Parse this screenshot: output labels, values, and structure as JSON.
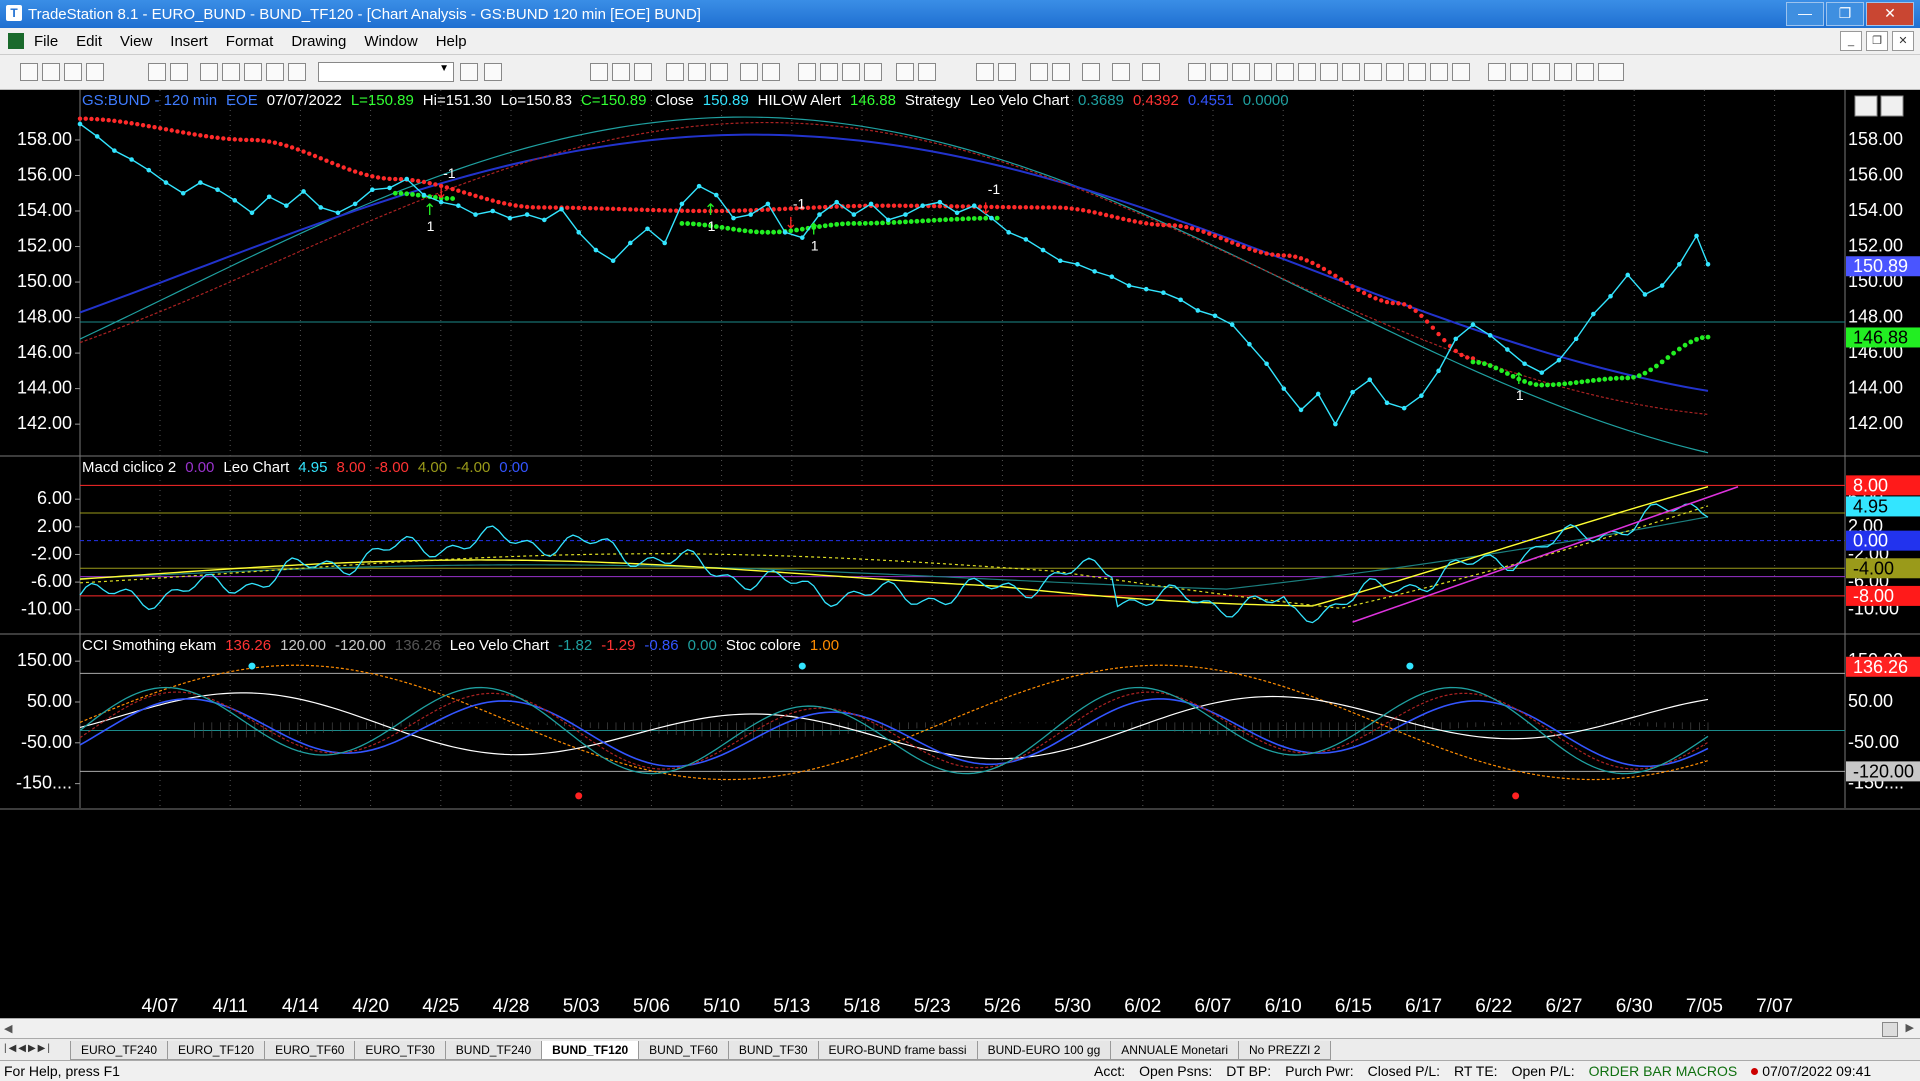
{
  "window": {
    "title": "TradeStation 8.1 - EURO_BUND - BUND_TF120 - [Chart Analysis - GS:BUND  120 min  [EOE] BUND]",
    "buttons": {
      "minimize": "—",
      "restore": "❐",
      "close": "✕"
    }
  },
  "menu": {
    "items": [
      "File",
      "Edit",
      "View",
      "Insert",
      "Format",
      "Drawing",
      "Window",
      "Help"
    ]
  },
  "chart_data": [
    {
      "type": "line",
      "panel": "price",
      "header_items": [
        {
          "text": "GS:BUND - 120 min",
          "color": "#3f7cff"
        },
        {
          "text": "EOE",
          "color": "#3f7cff"
        },
        {
          "text": "07/07/2022",
          "color": "#ffffff"
        },
        {
          "text": "L=150.89",
          "color": "#33ff33"
        },
        {
          "text": "Hi=151.30",
          "color": "#ffffff"
        },
        {
          "text": "Lo=150.83",
          "color": "#ffffff"
        },
        {
          "text": "C=150.89",
          "color": "#33ff33"
        },
        {
          "text": "Close",
          "color": "#ffffff"
        },
        {
          "text": "150.89",
          "color": "#33e5ff"
        },
        {
          "text": "HILOW Alert",
          "color": "#ffffff"
        },
        {
          "text": "146.88",
          "color": "#33ff33"
        },
        {
          "text": "Strategy",
          "color": "#ffffff"
        },
        {
          "text": "Leo Velo Chart",
          "color": "#ffffff"
        },
        {
          "text": "0.3689",
          "color": "#1fa0a0"
        },
        {
          "text": "0.4392",
          "color": "#ff3333"
        },
        {
          "text": "0.4551",
          "color": "#3355ff"
        },
        {
          "text": "0.0000",
          "color": "#1fa0a0"
        }
      ],
      "y_ticks": [
        "158.00",
        "156.00",
        "154.00",
        "152.00",
        "150.00",
        "148.00",
        "146.00",
        "144.00",
        "142.00"
      ],
      "ylim": [
        140.6,
        159.8
      ],
      "right_badges": [
        {
          "text": "150.89",
          "value": 150.89,
          "bg": "#4a55ff",
          "fg": "#ffffff"
        },
        {
          "text": "146.88",
          "value": 146.88,
          "bg": "#22ee22",
          "fg": "#000000"
        }
      ],
      "horizontal_lines": [
        {
          "value": 147.75,
          "color": "#1b8a8a"
        }
      ],
      "close_series": [
        {
          "x": 0,
          "y": 158.9
        },
        {
          "x": 3,
          "y": 158.2
        },
        {
          "x": 6,
          "y": 157.4
        },
        {
          "x": 9,
          "y": 156.9
        },
        {
          "x": 12,
          "y": 156.3
        },
        {
          "x": 15,
          "y": 155.6
        },
        {
          "x": 18,
          "y": 155.0
        },
        {
          "x": 21,
          "y": 155.6
        },
        {
          "x": 24,
          "y": 155.2
        },
        {
          "x": 27,
          "y": 154.6
        },
        {
          "x": 30,
          "y": 153.9
        },
        {
          "x": 33,
          "y": 154.8
        },
        {
          "x": 36,
          "y": 154.3
        },
        {
          "x": 39,
          "y": 155.1
        },
        {
          "x": 42,
          "y": 154.2
        },
        {
          "x": 45,
          "y": 153.9
        },
        {
          "x": 48,
          "y": 154.4
        },
        {
          "x": 51,
          "y": 155.2
        },
        {
          "x": 54,
          "y": 155.3
        },
        {
          "x": 57,
          "y": 155.8
        },
        {
          "x": 60,
          "y": 154.9
        },
        {
          "x": 63,
          "y": 154.5
        },
        {
          "x": 66,
          "y": 154.3
        },
        {
          "x": 69,
          "y": 153.8
        },
        {
          "x": 72,
          "y": 154.0
        },
        {
          "x": 75,
          "y": 153.6
        },
        {
          "x": 78,
          "y": 153.8
        },
        {
          "x": 81,
          "y": 153.5
        },
        {
          "x": 84,
          "y": 154.1
        },
        {
          "x": 87,
          "y": 152.8
        },
        {
          "x": 90,
          "y": 151.8
        },
        {
          "x": 93,
          "y": 151.2
        },
        {
          "x": 96,
          "y": 152.2
        },
        {
          "x": 99,
          "y": 153.0
        },
        {
          "x": 102,
          "y": 152.2
        },
        {
          "x": 105,
          "y": 154.4
        },
        {
          "x": 108,
          "y": 155.4
        },
        {
          "x": 111,
          "y": 154.9
        },
        {
          "x": 114,
          "y": 153.6
        },
        {
          "x": 117,
          "y": 153.8
        },
        {
          "x": 120,
          "y": 154.4
        },
        {
          "x": 123,
          "y": 152.8
        },
        {
          "x": 126,
          "y": 152.5
        },
        {
          "x": 129,
          "y": 153.8
        },
        {
          "x": 132,
          "y": 154.5
        },
        {
          "x": 135,
          "y": 153.8
        },
        {
          "x": 138,
          "y": 154.4
        },
        {
          "x": 141,
          "y": 153.5
        },
        {
          "x": 144,
          "y": 153.8
        },
        {
          "x": 147,
          "y": 154.3
        },
        {
          "x": 150,
          "y": 154.5
        },
        {
          "x": 153,
          "y": 153.9
        },
        {
          "x": 156,
          "y": 154.3
        },
        {
          "x": 159,
          "y": 153.6
        },
        {
          "x": 162,
          "y": 152.8
        },
        {
          "x": 165,
          "y": 152.4
        },
        {
          "x": 168,
          "y": 151.8
        },
        {
          "x": 171,
          "y": 151.2
        },
        {
          "x": 174,
          "y": 151.0
        },
        {
          "x": 177,
          "y": 150.6
        },
        {
          "x": 180,
          "y": 150.3
        },
        {
          "x": 183,
          "y": 149.8
        },
        {
          "x": 186,
          "y": 149.6
        },
        {
          "x": 189,
          "y": 149.4
        },
        {
          "x": 192,
          "y": 149.0
        },
        {
          "x": 195,
          "y": 148.4
        },
        {
          "x": 198,
          "y": 148.1
        },
        {
          "x": 201,
          "y": 147.6
        },
        {
          "x": 204,
          "y": 146.5
        },
        {
          "x": 207,
          "y": 145.4
        },
        {
          "x": 210,
          "y": 144.0
        },
        {
          "x": 213,
          "y": 142.8
        },
        {
          "x": 216,
          "y": 143.7
        },
        {
          "x": 219,
          "y": 142.0
        },
        {
          "x": 222,
          "y": 143.8
        },
        {
          "x": 225,
          "y": 144.5
        },
        {
          "x": 228,
          "y": 143.2
        },
        {
          "x": 231,
          "y": 142.9
        },
        {
          "x": 234,
          "y": 143.6
        },
        {
          "x": 237,
          "y": 145.0
        },
        {
          "x": 240,
          "y": 146.8
        },
        {
          "x": 243,
          "y": 147.6
        },
        {
          "x": 246,
          "y": 147.0
        },
        {
          "x": 249,
          "y": 146.2
        },
        {
          "x": 252,
          "y": 145.4
        },
        {
          "x": 255,
          "y": 144.9
        },
        {
          "x": 258,
          "y": 145.6
        },
        {
          "x": 261,
          "y": 146.8
        },
        {
          "x": 264,
          "y": 148.2
        },
        {
          "x": 267,
          "y": 149.2
        },
        {
          "x": 270,
          "y": 150.4
        },
        {
          "x": 273,
          "y": 149.3
        },
        {
          "x": 276,
          "y": 149.8
        },
        {
          "x": 279,
          "y": 151.0
        },
        {
          "x": 282,
          "y": 152.6
        },
        {
          "x": 284,
          "y": 151.0
        }
      ],
      "red_stop_series": [
        {
          "x": 0,
          "y": 159.2
        },
        {
          "x": 30,
          "y": 158.0
        },
        {
          "x": 55,
          "y": 155.8
        },
        {
          "x": 80,
          "y": 154.2
        },
        {
          "x": 110,
          "y": 154.0
        },
        {
          "x": 140,
          "y": 154.3
        },
        {
          "x": 170,
          "y": 154.2
        },
        {
          "x": 190,
          "y": 153.2
        },
        {
          "x": 210,
          "y": 151.5
        },
        {
          "x": 230,
          "y": 148.8
        },
        {
          "x": 243,
          "y": 145.7
        }
      ],
      "green_stop_series": [
        {
          "type": "segment",
          "points": [
            {
              "x": 55,
              "y": 155.0
            },
            {
              "x": 65,
              "y": 154.7
            }
          ]
        },
        {
          "type": "segment",
          "points": [
            {
              "x": 105,
              "y": 153.3
            },
            {
              "x": 120,
              "y": 152.8
            },
            {
              "x": 135,
              "y": 153.3
            },
            {
              "x": 160,
              "y": 153.6
            }
          ]
        },
        {
          "type": "segment",
          "points": [
            {
              "x": 243,
              "y": 145.5
            },
            {
              "x": 255,
              "y": 144.2
            },
            {
              "x": 270,
              "y": 144.6
            },
            {
              "x": 284,
              "y": 146.9
            }
          ]
        }
      ],
      "signals": [
        {
          "x": 63,
          "label": "-1",
          "dir": "down"
        },
        {
          "x": 61,
          "label": "1",
          "dir": "up"
        },
        {
          "x": 110,
          "label": "1",
          "dir": "up"
        },
        {
          "x": 124,
          "label": "-1",
          "dir": "down"
        },
        {
          "x": 128,
          "label": "1",
          "dir": "up"
        },
        {
          "x": 158,
          "label": "-1",
          "dir": "down"
        },
        {
          "x": 251,
          "label": "1",
          "dir": "up"
        }
      ],
      "x_ticks": [
        "4/07",
        "4/11",
        "4/14",
        "4/20",
        "4/25",
        "4/28",
        "5/03",
        "5/06",
        "5/10",
        "5/13",
        "5/18",
        "5/23",
        "5/26",
        "5/30",
        "6/02",
        "6/07",
        "6/10",
        "6/15",
        "6/17",
        "6/22",
        "6/27",
        "6/30",
        "7/05",
        "7/07"
      ]
    },
    {
      "type": "line",
      "panel": "macd",
      "header_items": [
        {
          "text": "Macd ciclico 2",
          "color": "#ffffff"
        },
        {
          "text": "0.00",
          "color": "#9933cc"
        },
        {
          "text": "Leo Chart",
          "color": "#ffffff"
        },
        {
          "text": "4.95",
          "color": "#33e5ff"
        },
        {
          "text": "8.00",
          "color": "#ff3333"
        },
        {
          "text": "-8.00",
          "color": "#ff3333"
        },
        {
          "text": "4.00",
          "color": "#9a9a1a"
        },
        {
          "text": "-4.00",
          "color": "#9a9a1a"
        },
        {
          "text": "0.00",
          "color": "#3355ff"
        }
      ],
      "y_ticks": [
        "6.00",
        "2.00",
        "-2.00",
        "-6.00",
        "-10.00"
      ],
      "ylim": [
        -12.5,
        9.5
      ],
      "right_badges": [
        {
          "text": "8.00",
          "value": 8.0,
          "bg": "#ff1a1a",
          "fg": "#ffffff"
        },
        {
          "text": "4.95",
          "value": 4.95,
          "bg": "#33e5ff",
          "fg": "#000000"
        },
        {
          "text": "0.00",
          "value": 0.0,
          "bg": "#2233ee",
          "fg": "#ffffff"
        },
        {
          "text": "-4.00",
          "value": -4.0,
          "bg": "#9a9a1a",
          "fg": "#000000"
        },
        {
          "text": "-8.00",
          "value": -8.0,
          "bg": "#ff1a1a",
          "fg": "#ffffff"
        }
      ]
    },
    {
      "type": "line",
      "panel": "cci",
      "header_items": [
        {
          "text": "CCI Smothing ekam",
          "color": "#ffffff"
        },
        {
          "text": "136.26",
          "color": "#ff3333"
        },
        {
          "text": "120.00",
          "color": "#c8c8c8"
        },
        {
          "text": "-120.00",
          "color": "#c8c8c8"
        },
        {
          "text": "136.26",
          "color": "#555555"
        },
        {
          "text": "Leo Velo Chart",
          "color": "#ffffff"
        },
        {
          "text": "-1.82",
          "color": "#1fa0a0"
        },
        {
          "text": "-1.29",
          "color": "#ff3333"
        },
        {
          "text": "-0.86",
          "color": "#3355ff"
        },
        {
          "text": "0.00",
          "color": "#1fa0a0"
        },
        {
          "text": "Stoc colore",
          "color": "#ffffff"
        },
        {
          "text": "1.00",
          "color": "#ff8c00"
        }
      ],
      "y_ticks": [
        "150.00",
        "50.00",
        "-50.00",
        "-150...."
      ],
      "ylim": [
        -195,
        170
      ],
      "right_badges": [
        {
          "text": "136.26",
          "value": 136.26,
          "bg": "#ff2222",
          "fg": "#ffffff"
        },
        {
          "text": "-120.00",
          "value": -120.0,
          "bg": "#c8c8c8",
          "fg": "#000000"
        }
      ]
    }
  ],
  "sheets": [
    "EURO_TF240",
    "EURO_TF120",
    "EURO_TF60",
    "EURO_TF30",
    "BUND_TF240",
    "BUND_TF120",
    "BUND_TF60",
    "BUND_TF30",
    "EURO-BUND frame bassi",
    "BUND-EURO 100 gg",
    "ANNUALE Monetari",
    "No PREZZI 2"
  ],
  "active_sheet": "BUND_TF120",
  "status": {
    "help": "For Help, press F1",
    "fields": [
      "Acct:",
      "Open Psns:",
      "DT BP:",
      "Purch Pwr:",
      "Closed P/L:",
      "RT TE:",
      "Open P/L:"
    ],
    "macros": "ORDER BAR  MACROS",
    "datetime": "07/07/2022 09:41"
  }
}
